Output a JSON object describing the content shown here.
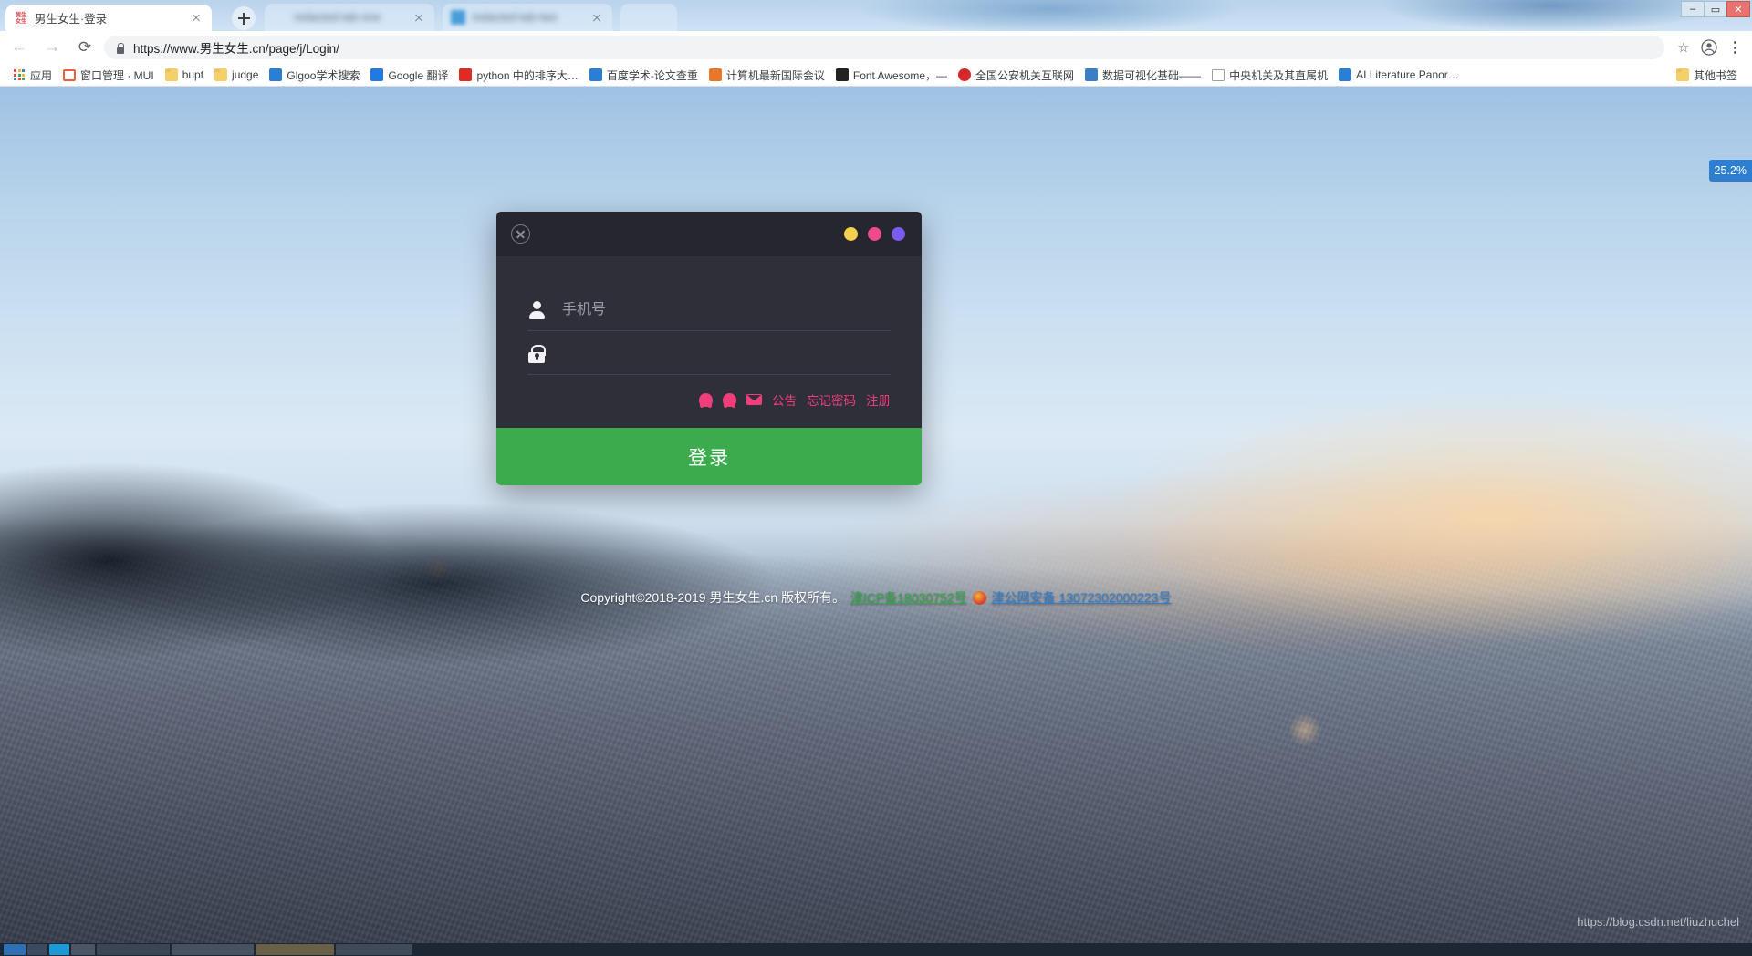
{
  "browser": {
    "tabs": [
      {
        "title": "男生女生·登录",
        "favicon": "site-icon",
        "active": true,
        "blurred": false
      },
      {
        "title": "redacted-tab-one",
        "favicon": "generic-icon",
        "active": false,
        "blurred": true
      },
      {
        "title": "redacted-tab-two",
        "favicon": "blue-app-icon",
        "active": false,
        "blurred": true
      },
      {
        "title": "",
        "favicon": "generic-icon",
        "active": false,
        "blurred": true
      }
    ],
    "new_tab_label": "+",
    "window_controls": {
      "minimize": "–",
      "maximize": "▭",
      "close": "✕"
    },
    "nav": {
      "back": "←",
      "forward": "→",
      "reload": "⟳",
      "bookmark_star": "☆",
      "profile": "account-icon",
      "menu": "kebab-menu"
    },
    "omnibox": {
      "lock": "secure-lock-icon",
      "url": "https://www.男生女生.cn/page/j/Login/"
    },
    "bookmarks": [
      {
        "label": "应用",
        "icon": "apps-grid-icon"
      },
      {
        "label": "窗口管理 · MUI",
        "icon": "mui-icon"
      },
      {
        "label": "bupt",
        "icon": "folder-icon"
      },
      {
        "label": "judge",
        "icon": "folder-icon"
      },
      {
        "label": "Glgoo学术搜索",
        "icon": "scholar-icon"
      },
      {
        "label": "Google 翻译",
        "icon": "translate-icon"
      },
      {
        "label": "python 中的排序大…",
        "icon": "csdn-icon"
      },
      {
        "label": "百度学术-论文查重",
        "icon": "baidu-icon"
      },
      {
        "label": "计算机最新国际会议",
        "icon": "conference-icon"
      },
      {
        "label": "Font Awesome，—",
        "icon": "fontawesome-icon"
      },
      {
        "label": "全国公安机关互联网",
        "icon": "police-badge-icon"
      },
      {
        "label": "数据可视化基础——",
        "icon": "chart-icon"
      },
      {
        "label": "中央机关及其直属机",
        "icon": "document-icon"
      },
      {
        "label": "AI Literature Panor…",
        "icon": "ai-icon"
      }
    ],
    "bookmarks_overflow": {
      "label": "其他书签",
      "icon": "folder-icon"
    }
  },
  "page": {
    "zoom_indicator": "25.2%",
    "login": {
      "close_icon": "close-circle-icon",
      "decoration_dots": [
        {
          "name": "dot-yellow",
          "color": "#f5cf4e"
        },
        {
          "name": "dot-pink",
          "color": "#ef4a8c"
        },
        {
          "name": "dot-purple",
          "color": "#7b5cf0"
        }
      ],
      "fields": [
        {
          "icon": "user-icon",
          "placeholder": "手机号",
          "value": "",
          "type": "text",
          "name": "phone-input"
        },
        {
          "icon": "lock-icon",
          "placeholder": "",
          "value": "",
          "type": "password",
          "name": "password-input"
        }
      ],
      "social_icons": [
        {
          "name": "qq-icon",
          "color": "#ef3e7a"
        },
        {
          "name": "qq-icon-2",
          "color": "#ef3e7a"
        },
        {
          "name": "mail-icon",
          "color": "#ef3e7a"
        }
      ],
      "links": [
        {
          "label": "公告",
          "name": "announcement-link"
        },
        {
          "label": "忘记密码",
          "name": "forgot-password-link"
        },
        {
          "label": "注册",
          "name": "register-link"
        }
      ],
      "submit_label": "登录",
      "accent_color": "#3cab4e",
      "link_color": "#ef3e7a"
    },
    "footer": {
      "copyright": "Copyright©2018-2019 男生女生.cn 版权所有。",
      "icp": "津ICP备18030752号",
      "gongan_badge": "police-badge-icon",
      "gongan": "津公网安备 13072302000223号"
    },
    "watermark": "https://blog.csdn.net/liuzhuchel"
  }
}
